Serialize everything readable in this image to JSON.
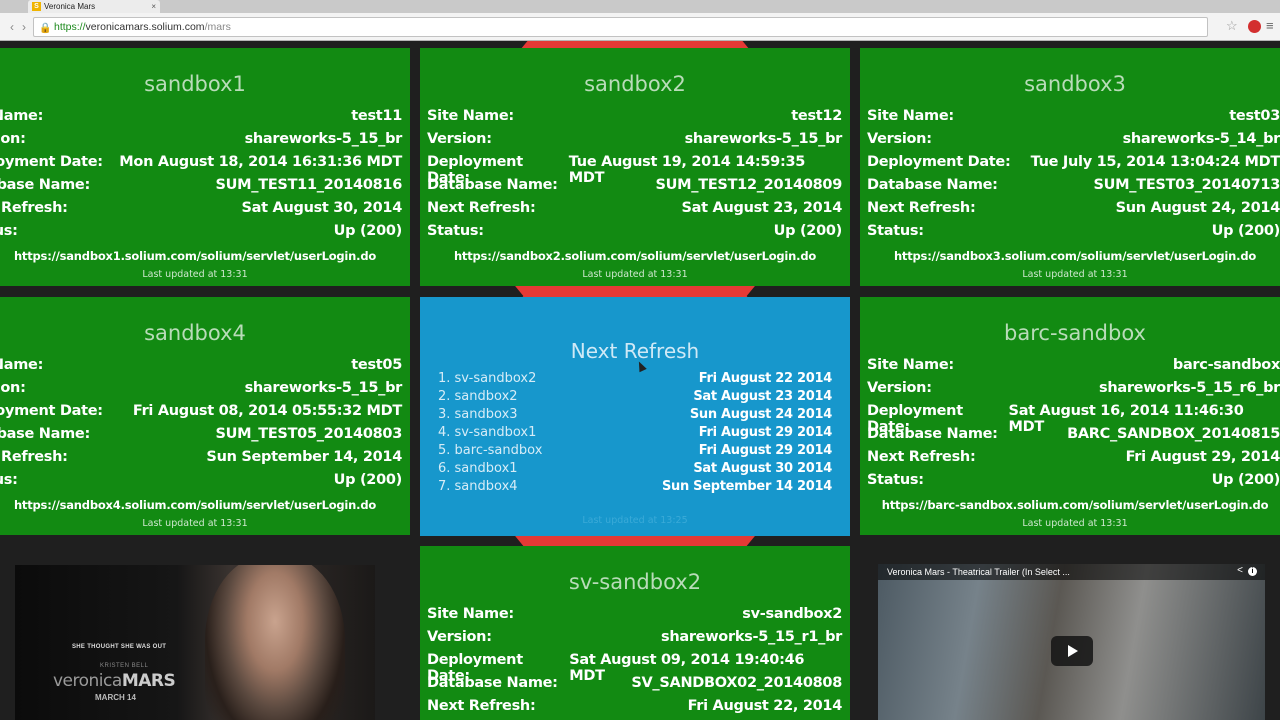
{
  "browser": {
    "tab_title": "Veronica Mars",
    "favicon_letter": "S",
    "tab_close": "×",
    "url_scheme": "https://",
    "url_host": "veronicamars.solium.com",
    "url_path": "/mars"
  },
  "labels": {
    "site_name": "Site Name:",
    "version": "Version:",
    "deployment_date": "Deployment Date:",
    "database_name": "Database Name:",
    "next_refresh": "Next Refresh:",
    "status": "Status:"
  },
  "sandboxes": [
    {
      "name": "sandbox1",
      "site_name": "test11",
      "version": "shareworks-5_15_br",
      "deployment_date": "Mon August 18, 2014 16:31:36 MDT",
      "database_name": "SUM_TEST11_20140816",
      "next_refresh": "Sat August 30, 2014",
      "status": "Up (200)",
      "url": "https://sandbox1.solium.com/solium/servlet/userLogin.do",
      "updated": "Last updated at 13:31",
      "label_site_name": "te Name:",
      "label_version": "ersion:",
      "label_deployment_date": "eployment Date:",
      "label_database_name": "atabase Name:",
      "label_next_refresh": "ext Refresh:",
      "label_status": "tatus:"
    },
    {
      "name": "sandbox2",
      "site_name": "test12",
      "version": "shareworks-5_15_br",
      "deployment_date": "Tue August 19, 2014 14:59:35 MDT",
      "database_name": "SUM_TEST12_20140809",
      "next_refresh": "Sat August 23, 2014",
      "status": "Up (200)",
      "url": "https://sandbox2.solium.com/solium/servlet/userLogin.do",
      "updated": "Last updated at 13:31"
    },
    {
      "name": "sandbox3",
      "site_name": "test03",
      "version": "shareworks-5_14_br",
      "deployment_date": "Tue July 15, 2014 13:04:24 MDT",
      "database_name": "SUM_TEST03_20140713",
      "next_refresh": "Sun August 24, 2014",
      "status": "Up (200)",
      "url": "https://sandbox3.solium.com/solium/servlet/userLogin.do",
      "updated": "Last updated at 13:31"
    },
    {
      "name": "sandbox4",
      "site_name": "test05",
      "version": "shareworks-5_15_br",
      "deployment_date": "Fri August 08, 2014 05:55:32 MDT",
      "database_name": "SUM_TEST05_20140803",
      "next_refresh": "Sun September 14, 2014",
      "status": "Up (200)",
      "url": "https://sandbox4.solium.com/solium/servlet/userLogin.do",
      "updated": "Last updated at 13:31",
      "label_site_name": "te Name:",
      "label_version": "ersion:",
      "label_deployment_date": "eployment Date:",
      "label_database_name": "atabase Name:",
      "label_next_refresh": "ext Refresh:",
      "label_status": "tatus:"
    },
    {
      "name": "barc-sandbox",
      "site_name": "barc-sandbox",
      "version": "shareworks-5_15_r6_br",
      "deployment_date": "Sat August 16, 2014 11:46:30 MDT",
      "database_name": "BARC_SANDBOX_20140815",
      "next_refresh": "Fri August 29, 2014",
      "status": "Up (200)",
      "url": "https://barc-sandbox.solium.com/solium/servlet/userLogin.do",
      "updated": "Last updated at 13:31"
    },
    {
      "name": "sv-sandbox2",
      "site_name": "sv-sandbox2",
      "version": "shareworks-5_15_r1_br",
      "deployment_date": "Sat August 09, 2014 19:40:46 MDT",
      "database_name": "SV_SANDBOX02_20140808",
      "next_refresh": "Fri August 22, 2014"
    }
  ],
  "refresh_panel": {
    "title": "Next Refresh",
    "items": [
      {
        "name": "1. sv-sandbox2",
        "date": "Fri August 22 2014"
      },
      {
        "name": "2. sandbox2",
        "date": "Sat August 23 2014"
      },
      {
        "name": "3. sandbox3",
        "date": "Sun August 24 2014"
      },
      {
        "name": "4. sv-sandbox1",
        "date": "Fri August 29 2014"
      },
      {
        "name": "5. barc-sandbox",
        "date": "Fri August 29 2014"
      },
      {
        "name": "6. sandbox1",
        "date": "Sat August 30 2014"
      },
      {
        "name": "7. sandbox4",
        "date": "Sun September 14 2014"
      }
    ],
    "updated": "Last updated at 13:25"
  },
  "poster": {
    "tagline": "SHE THOUGHT SHE WAS OUT",
    "actor": "KRISTEN BELL",
    "logo_light": "veronica",
    "logo_bold": "MARS",
    "date": "MARCH 14"
  },
  "video": {
    "title": "Veronica Mars - Theatrical Trailer (In Select ...",
    "share_icon": "<",
    "info_icon": "i"
  }
}
